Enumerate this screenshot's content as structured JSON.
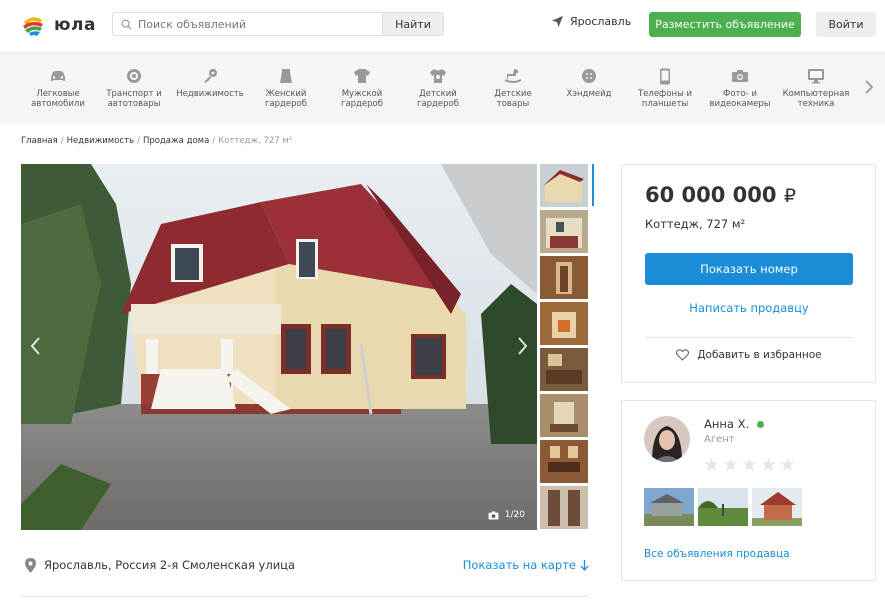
{
  "header": {
    "logo_text": "юла",
    "search_placeholder": "Поиск объявлений",
    "search_button": "Найти",
    "city": "Ярославль",
    "post_button": "Разместить объявление",
    "login_button": "Войти",
    "accent_color": "#4caf50",
    "link_color": "#1a8cd8"
  },
  "categories": [
    {
      "label": "Легковые\nавтомобили",
      "icon": "car-icon"
    },
    {
      "label": "Транспорт и\nавтотовары",
      "icon": "wheel-icon"
    },
    {
      "label": "Недвижимость",
      "icon": "key-icon"
    },
    {
      "label": "Женский\nгардероб",
      "icon": "skirt-icon"
    },
    {
      "label": "Мужской\nгардероб",
      "icon": "shirt-icon"
    },
    {
      "label": "Детский\nгардероб",
      "icon": "kids-shirt-icon"
    },
    {
      "label": "Детские\nтовары",
      "icon": "rocking-horse-icon"
    },
    {
      "label": "Хэндмейд",
      "icon": "button-icon"
    },
    {
      "label": "Телефоны и\nпланшеты",
      "icon": "phone-icon"
    },
    {
      "label": "Фото- и\nвидеокамеры",
      "icon": "camera-icon"
    },
    {
      "label": "Компьютерная\nтехника",
      "icon": "monitor-icon"
    }
  ],
  "breadcrumbs": [
    "Главная",
    "Недвижимость",
    "Продажа дома",
    "Коттедж, 727 м²"
  ],
  "gallery": {
    "counter": "1/20"
  },
  "address": {
    "text": "Ярославль, Россия 2-я Смоленская улица",
    "map_link": "Показать на карте"
  },
  "listing": {
    "price": "60 000 000",
    "currency": "₽",
    "title": "Коттедж, 727 м²",
    "show_number": "Показать номер",
    "write_seller": "Написать продавцу",
    "favorite": "Добавить в избранное"
  },
  "seller": {
    "name": "Анна Х.",
    "role": "Агент",
    "rating": 0,
    "max_rating": 5,
    "all_ads": "Все объявления продавца"
  }
}
